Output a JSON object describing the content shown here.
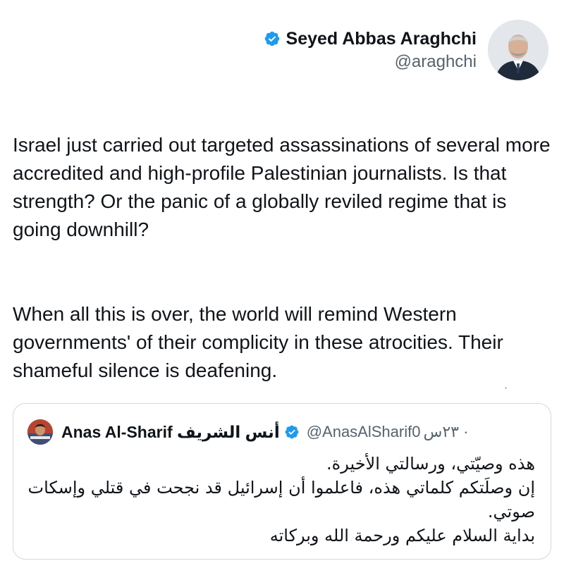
{
  "author": {
    "display_name": "Seyed Abbas Araghchi",
    "handle": "@araghchi",
    "verified_icon": "verified-badge-icon",
    "verified_color": "#1d9bf0"
  },
  "tweet": {
    "paragraph_1": "Israel just carried out targeted assassinations of several more accredited and high-profile Palestinian journalists. Is that strength? Or the panic of a globally reviled regime that is going downhill?",
    "paragraph_2": "When all this is over, the world will remind Western governments' of their complicity in these atrocities. Their shameful silence is deafening."
  },
  "quote": {
    "display_name": "Anas Al-Sharif أنس الشريف",
    "handle": "@AnasAlSharif0",
    "time": "· ٢٣س",
    "verified_icon": "verified-badge-icon",
    "lines": [
      "هذه وصيّتي، ورسالتي الأخيرة.",
      "إن وصلَتكم كلماتي هذه، فاعلموا أن إسرائيل قد نجحت في قتلي وإسكات صوتي.",
      "بداية السلام عليكم ورحمة الله وبركاته"
    ]
  }
}
